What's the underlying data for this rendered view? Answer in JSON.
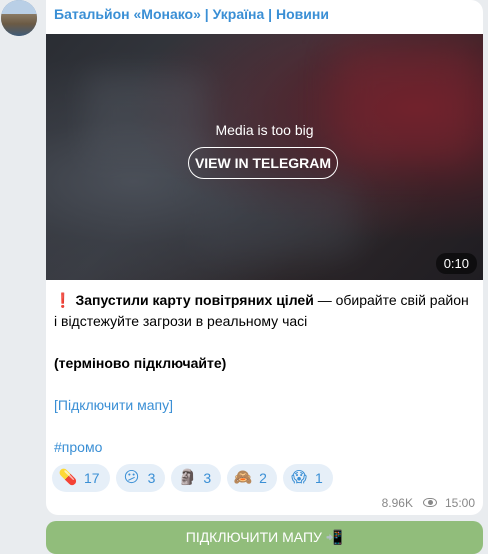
{
  "message": {
    "channel_title": "Батальйон «Монако» | Україна | Новини",
    "media": {
      "notice": "Media is too big",
      "view_button": "VIEW IN TELEGRAM",
      "duration": "0:10"
    },
    "text": {
      "headline_icon": "❗",
      "headline_bold": "Запустили карту повітряних цілей",
      "headline_rest": " — обирайте свій район і відстежуйте загрози в реальному часі",
      "urgent": "(терміново підключайте)",
      "connect_link": "[Підключити мапу]",
      "hashtag": "#промо"
    },
    "reactions": [
      {
        "icon": "pill-icon",
        "emoji": "💊",
        "count": "17"
      },
      {
        "icon": "confused-face-icon",
        "emoji": "😕",
        "count": "3"
      },
      {
        "icon": "moai-icon",
        "emoji": "🗿",
        "count": "3"
      },
      {
        "icon": "see-no-evil-monkey-icon",
        "emoji": "🙈",
        "count": "2"
      },
      {
        "icon": "scream-face-icon",
        "emoji": "😱",
        "count": "1"
      }
    ],
    "views": "8.96K",
    "time": "15:00"
  },
  "cta_button": {
    "label": "ПІДКЛЮЧИТИ МАПУ 📲"
  }
}
